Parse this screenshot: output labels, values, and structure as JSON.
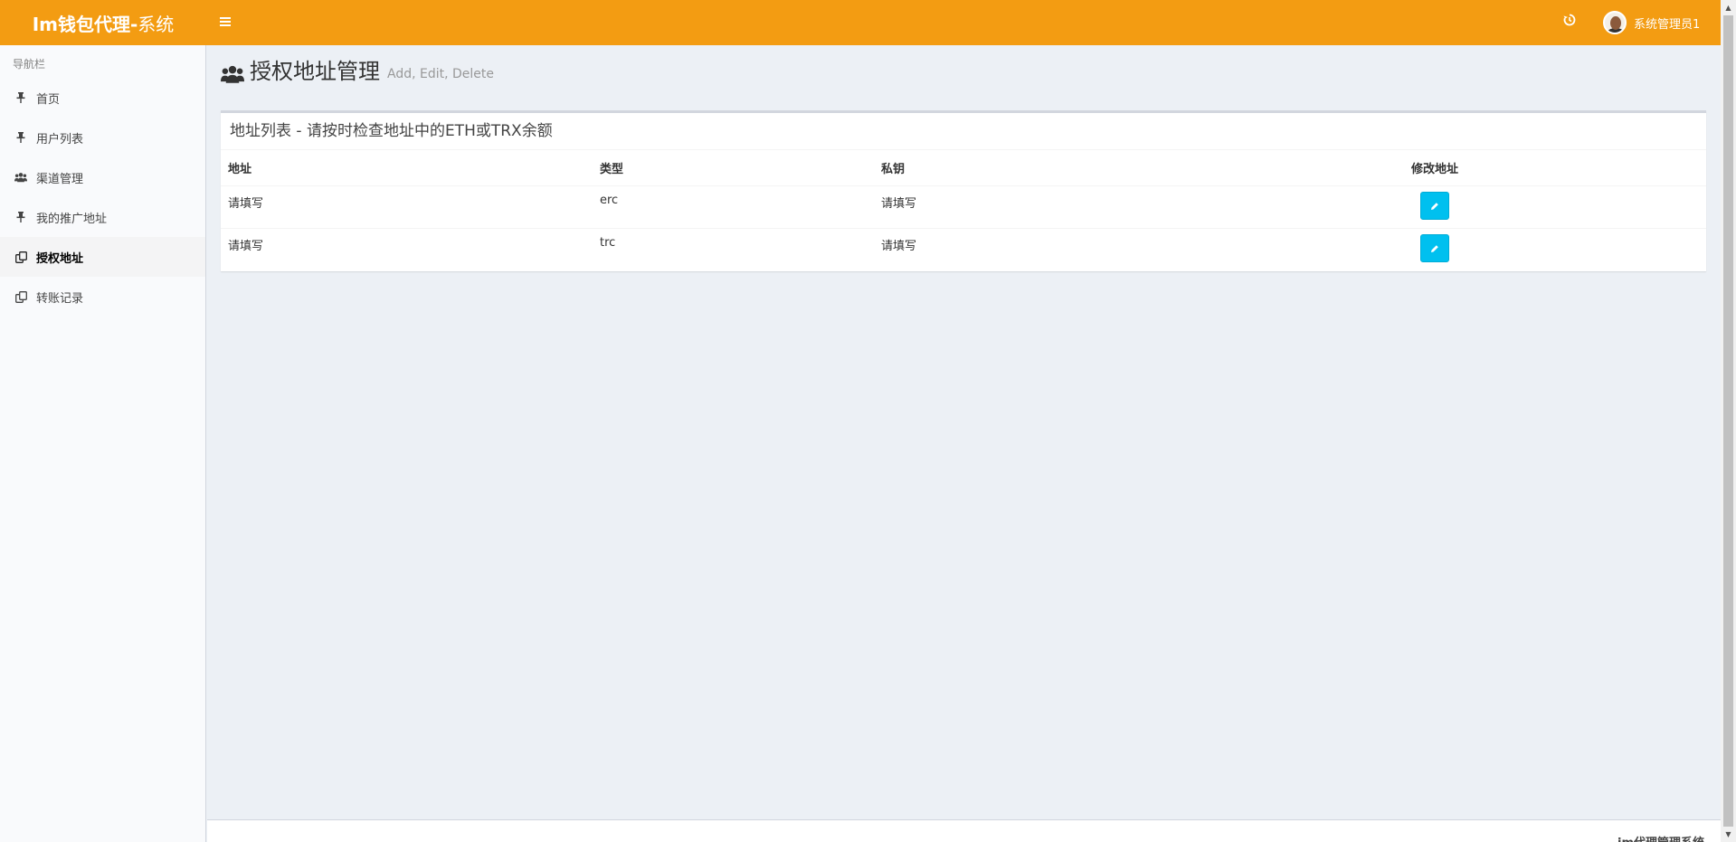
{
  "header": {
    "logo_bold": "Im钱包代理-",
    "logo_light": "系统",
    "user_name": "系统管理员1"
  },
  "sidebar": {
    "header": "导航栏",
    "items": [
      {
        "label": "首页",
        "icon": "pin-icon"
      },
      {
        "label": "用户列表",
        "icon": "pin-icon"
      },
      {
        "label": "渠道管理",
        "icon": "users-icon"
      },
      {
        "label": "我的推广地址",
        "icon": "pin-icon"
      },
      {
        "label": "授权地址",
        "icon": "copy-icon",
        "active": true
      },
      {
        "label": "转账记录",
        "icon": "copy-icon"
      }
    ]
  },
  "page": {
    "title": "授权地址管理",
    "subtitle": "Add, Edit, Delete"
  },
  "box": {
    "title": "地址列表 - 请按时检查地址中的ETH或TRX余额",
    "columns": [
      "地址",
      "类型",
      "私钥",
      "修改地址"
    ],
    "rows": [
      {
        "address": "请填写",
        "type": "erc",
        "private_key": "请填写"
      },
      {
        "address": "请填写",
        "type": "trc",
        "private_key": "请填写"
      }
    ]
  },
  "footer": {
    "text": "im代理管理系统"
  },
  "colors": {
    "header": "#f39c12",
    "edit_button": "#00c0ef",
    "sidebar_bg": "#f9fafc",
    "content_bg": "#ecf0f5"
  }
}
